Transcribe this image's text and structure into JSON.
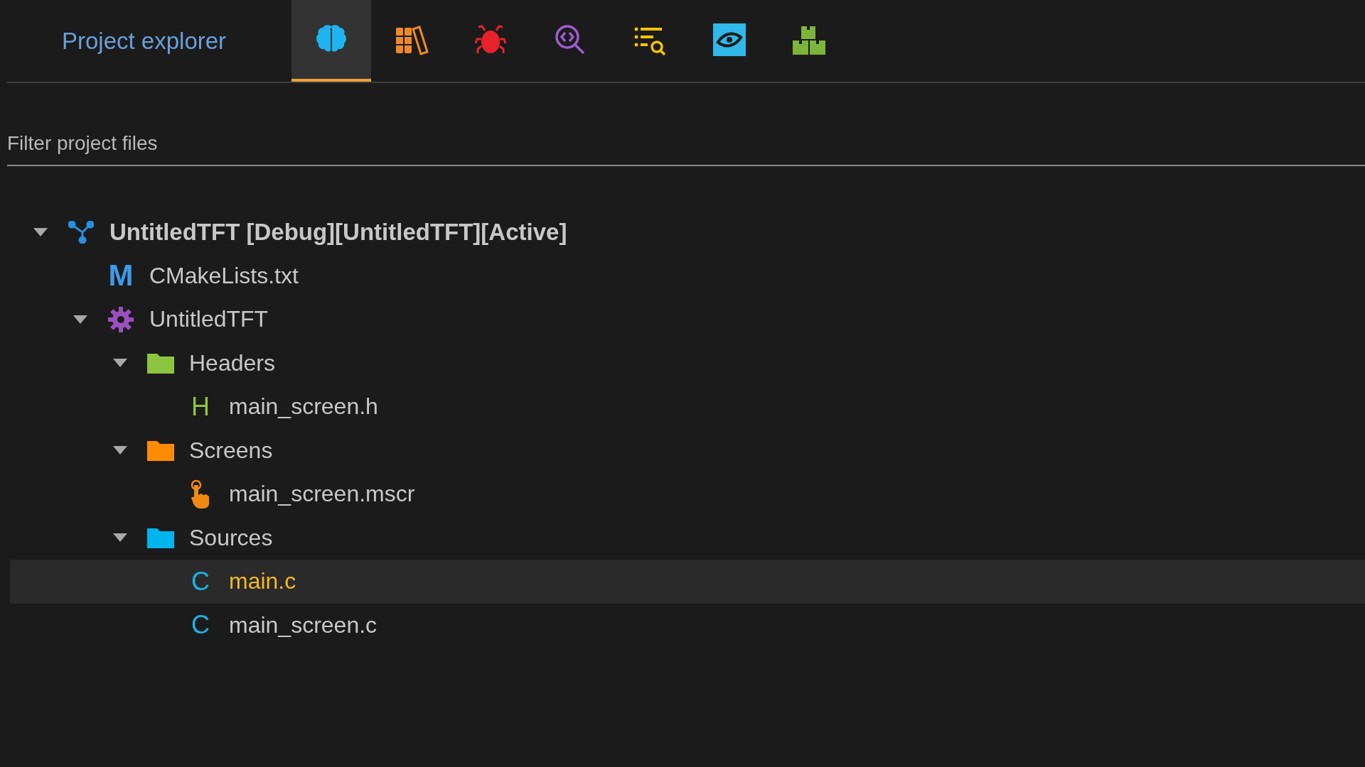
{
  "panel": {
    "title": "Project explorer"
  },
  "tabs": [
    {
      "kind": "brain",
      "selected": true
    },
    {
      "kind": "books",
      "selected": false
    },
    {
      "kind": "bug",
      "selected": false
    },
    {
      "kind": "code-search",
      "selected": false
    },
    {
      "kind": "list-search",
      "selected": false
    },
    {
      "kind": "eye-link",
      "selected": false
    },
    {
      "kind": "blocks",
      "selected": false
    }
  ],
  "filter": {
    "placeholder": "Filter project files"
  },
  "tree": [
    {
      "kind": "project",
      "label": "UntitledTFT [Debug][UntitledTFT][Active]",
      "expanded": true,
      "children": [
        {
          "kind": "file",
          "badge": "M",
          "color": "#3d9be9",
          "label": "CMakeLists.txt",
          "selected": false
        },
        {
          "kind": "target",
          "label": "UntitledTFT",
          "expanded": true,
          "children": [
            {
              "kind": "folder",
              "color": "#8cc63f",
              "label": "Headers",
              "expanded": true,
              "children": [
                {
                  "kind": "file",
                  "badge": "H",
                  "color": "#8cc63f",
                  "label": "main_screen.h",
                  "selected": false
                }
              ]
            },
            {
              "kind": "folder",
              "color": "#ff8c00",
              "label": "Screens",
              "expanded": true,
              "children": [
                {
                  "kind": "screen",
                  "label": "main_screen.mscr",
                  "selected": false
                }
              ]
            },
            {
              "kind": "folder",
              "color": "#00b4f0",
              "label": "Sources",
              "expanded": true,
              "children": [
                {
                  "kind": "file",
                  "badge": "C",
                  "color": "#1cb0e8",
                  "label": "main.c",
                  "selected": true
                },
                {
                  "kind": "file",
                  "badge": "C",
                  "color": "#1cb0e8",
                  "label": "main_screen.c",
                  "selected": false
                }
              ]
            }
          ]
        }
      ]
    }
  ]
}
